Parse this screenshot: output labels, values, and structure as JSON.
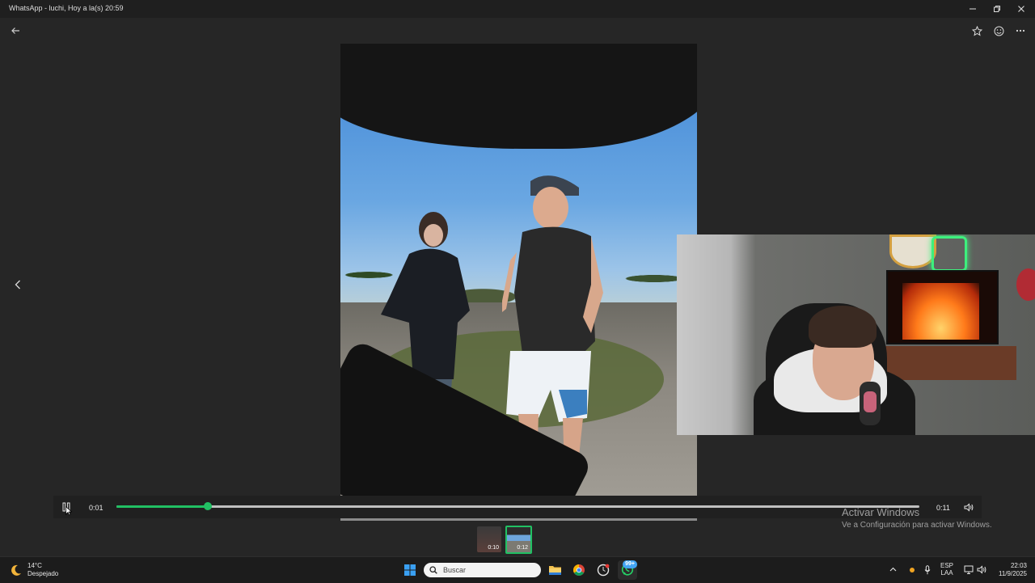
{
  "window": {
    "title": "WhatsApp - luchi, Hoy a la(s) 20:59"
  },
  "player": {
    "current_time": "0:01",
    "duration": "0:11",
    "progress": 0.114
  },
  "thumbnails": [
    {
      "duration": "0:10",
      "selected": false
    },
    {
      "duration": "0:12",
      "selected": true
    }
  ],
  "watermark": {
    "line1": "Activar Windows",
    "line2": "Ve a Configuración para activar Windows."
  },
  "taskbar": {
    "weather_temp": "14°C",
    "weather_desc": "Despejado",
    "search_placeholder": "Buscar",
    "whatsapp_badge": "99+",
    "lang_top": "ESP",
    "lang_bottom": "LAA",
    "time": "22:03",
    "date": "11/9/2025"
  },
  "colors": {
    "accent": "#21c063",
    "background": "#262626",
    "taskbar": "#1c1c1c"
  },
  "icons": {
    "back": "arrow-left-icon",
    "star": "star-icon",
    "react": "smiley-icon",
    "more": "more-horizontal-icon",
    "prev": "chevron-left-icon",
    "pause": "pause-icon",
    "volume": "volume-icon"
  }
}
